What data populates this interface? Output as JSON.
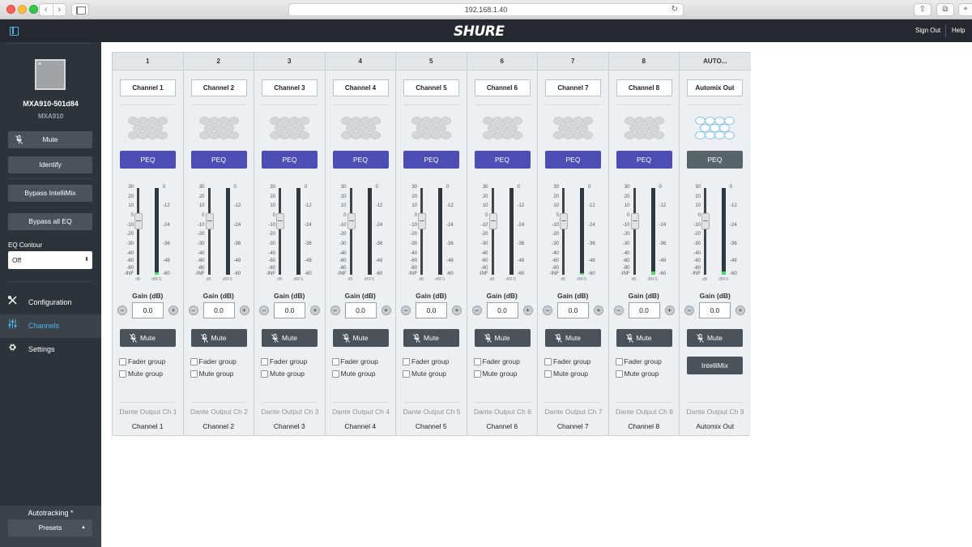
{
  "browser": {
    "url": "192.168.1.40",
    "back_glyph": "‹",
    "forward_glyph": "›",
    "reload_glyph": "↻",
    "share_glyph": "⇧",
    "tabs_glyph": "⧉",
    "new_tab_glyph": "+"
  },
  "header": {
    "logo": "SHURE",
    "sign_out": "Sign Out",
    "help": "Help"
  },
  "sidebar": {
    "device_name": "MXA910-501d84",
    "device_model": "MXA910",
    "mute_label": "Mute",
    "identify_label": "Identify",
    "bypass_intellimix_label": "Bypass IntelliMix",
    "bypass_eq_label": "Bypass all EQ",
    "eq_contour_label": "EQ Contour",
    "eq_contour_value": "Off",
    "nav": [
      {
        "label": "Configuration",
        "icon": "tools-icon"
      },
      {
        "label": "Channels",
        "icon": "sliders-icon"
      },
      {
        "label": "Settings",
        "icon": "gear-icon"
      }
    ],
    "autotracking_label": "Autotracking *",
    "presets_label": "Presets"
  },
  "channels": [
    {
      "header": "1",
      "name": "Channel 1",
      "peq": "PEQ",
      "gain_label": "Gain (dB)",
      "gain": "0.0",
      "mute": "Mute",
      "fader_group": "Fader group",
      "mute_group": "Mute group",
      "output": "Dante Output Ch 1",
      "output_name": "Channel 1",
      "meter_level": 0.03
    },
    {
      "header": "2",
      "name": "Channel 2",
      "peq": "PEQ",
      "gain_label": "Gain (dB)",
      "gain": "0.0",
      "mute": "Mute",
      "fader_group": "Fader group",
      "mute_group": "Mute group",
      "output": "Dante Output Ch 2",
      "output_name": "Channel 2",
      "meter_level": 0.0
    },
    {
      "header": "3",
      "name": "Channel 3",
      "peq": "PEQ",
      "gain_label": "Gain (dB)",
      "gain": "0.0",
      "mute": "Mute",
      "fader_group": "Fader group",
      "mute_group": "Mute group",
      "output": "Dante Output Ch 3",
      "output_name": "Channel 3",
      "meter_level": 0.0
    },
    {
      "header": "4",
      "name": "Channel 4",
      "peq": "PEQ",
      "gain_label": "Gain (dB)",
      "gain": "0.0",
      "mute": "Mute",
      "fader_group": "Fader group",
      "mute_group": "Mute group",
      "output": "Dante Output Ch 4",
      "output_name": "Channel 4",
      "meter_level": 0.0
    },
    {
      "header": "5",
      "name": "Channel 5",
      "peq": "PEQ",
      "gain_label": "Gain (dB)",
      "gain": "0.0",
      "mute": "Mute",
      "fader_group": "Fader group",
      "mute_group": "Mute group",
      "output": "Dante Output Ch 5",
      "output_name": "Channel 5",
      "meter_level": 0.0
    },
    {
      "header": "6",
      "name": "Channel 6",
      "peq": "PEQ",
      "gain_label": "Gain (dB)",
      "gain": "0.0",
      "mute": "Mute",
      "fader_group": "Fader group",
      "mute_group": "Mute group",
      "output": "Dante Output Ch 6",
      "output_name": "Channel 6",
      "meter_level": 0.0
    },
    {
      "header": "7",
      "name": "Channel 7",
      "peq": "PEQ",
      "gain_label": "Gain (dB)",
      "gain": "0.0",
      "mute": "Mute",
      "fader_group": "Fader group",
      "mute_group": "Mute group",
      "output": "Dante Output Ch 7",
      "output_name": "Channel 7",
      "meter_level": 0.02
    },
    {
      "header": "8",
      "name": "Channel 8",
      "peq": "PEQ",
      "gain_label": "Gain (dB)",
      "gain": "0.0",
      "mute": "Mute",
      "fader_group": "Fader group",
      "mute_group": "Mute group",
      "output": "Dante Output Ch 8",
      "output_name": "Channel 8",
      "meter_level": 0.04
    },
    {
      "header": "AUTO...",
      "name": "Automix Out",
      "peq": "PEQ",
      "gain_label": "Gain (dB)",
      "gain": "0.0",
      "mute": "Mute",
      "intellimix": "IntelliMix",
      "output": "Dante Output Ch 9",
      "output_name": "Automix Out",
      "meter_level": 0.04
    }
  ],
  "fader_scale": [
    "30",
    "20",
    "10",
    "0",
    "-10",
    "-20",
    "-30",
    "-40",
    "-60",
    "-80",
    "-INF"
  ],
  "meter_scale": [
    "0",
    "-12",
    "-24",
    "-36",
    "-48",
    "-60"
  ],
  "fader_unit": "dB",
  "meter_unit": "dBFS",
  "glyphs": {
    "minus": "−",
    "plus": "+",
    "updown": "⬍",
    "caret_up": "▲"
  },
  "colors": {
    "peq_active": "#4d4db3",
    "peq_inactive": "#59636a",
    "accent": "#4fb3e6",
    "meter_fill": "#4cd964"
  }
}
